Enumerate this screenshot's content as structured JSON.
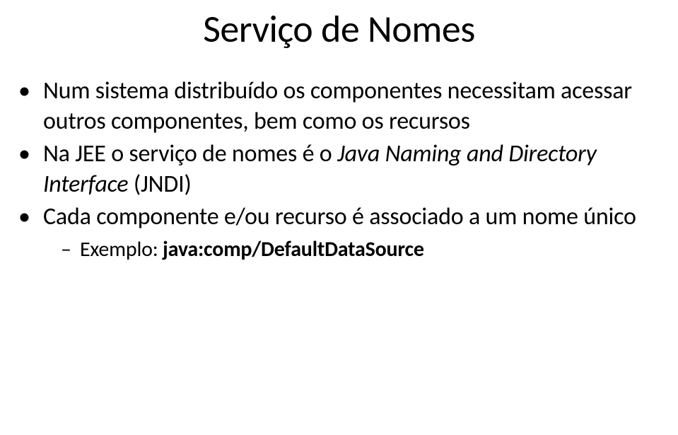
{
  "title": "Serviço de Nomes",
  "bullets": [
    {
      "text_parts": [
        {
          "text": "Num sistema distribuído os componentes necessitam acessar outros componentes, bem como os recursos",
          "italic": false
        }
      ]
    },
    {
      "text_parts": [
        {
          "text": "Na JEE o serviço de nomes é o ",
          "italic": false
        },
        {
          "text": "Java Naming and Directory Interface",
          "italic": true
        },
        {
          "text": " (JNDI)",
          "italic": false
        }
      ]
    },
    {
      "text_parts": [
        {
          "text": "Cada componente e/ou recurso é associado a um nome único",
          "italic": false
        }
      ],
      "sub": {
        "label": "Exemplo: ",
        "bold_text": "java:comp/DefaultDataSource"
      }
    }
  ]
}
